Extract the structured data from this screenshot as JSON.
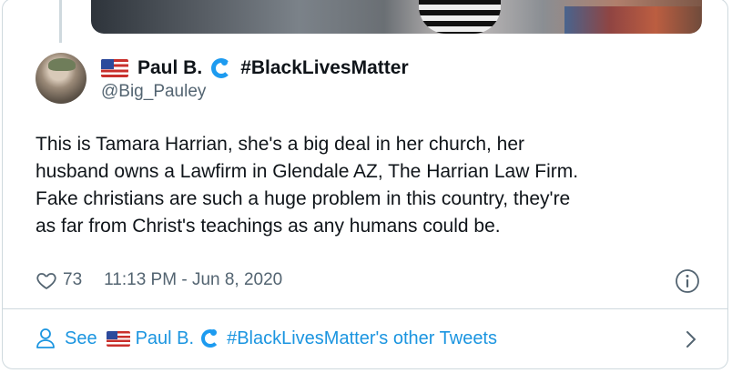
{
  "tweet": {
    "display_name": "Paul B.",
    "hashtag_name": "#BlackLivesMatter",
    "handle": "@Big_Pauley",
    "text_lines": [
      "This is Tamara Harrian, she's a big deal in her church, her",
      "husband owns a Lawfirm in Glendale AZ, The Harrian Law Firm.",
      "Fake christians are such a huge problem in this country, they're",
      "as far from Christ's teachings as any humans could be."
    ],
    "like_count": "73",
    "timestamp": "11:13 PM - Jun 8, 2020"
  },
  "footer": {
    "see_label": "See",
    "name": "Paul B.",
    "suffix": "#BlackLivesMatter's other Tweets"
  },
  "icons": {
    "flag": "us-flag-icon",
    "wave": "wave-icon",
    "heart": "heart-icon",
    "info": "info-icon",
    "person": "person-icon",
    "chevron": "chevron-right-icon"
  },
  "colors": {
    "link_blue": "#1b95e0",
    "secondary_text": "#536471",
    "border": "#cfd9de"
  }
}
